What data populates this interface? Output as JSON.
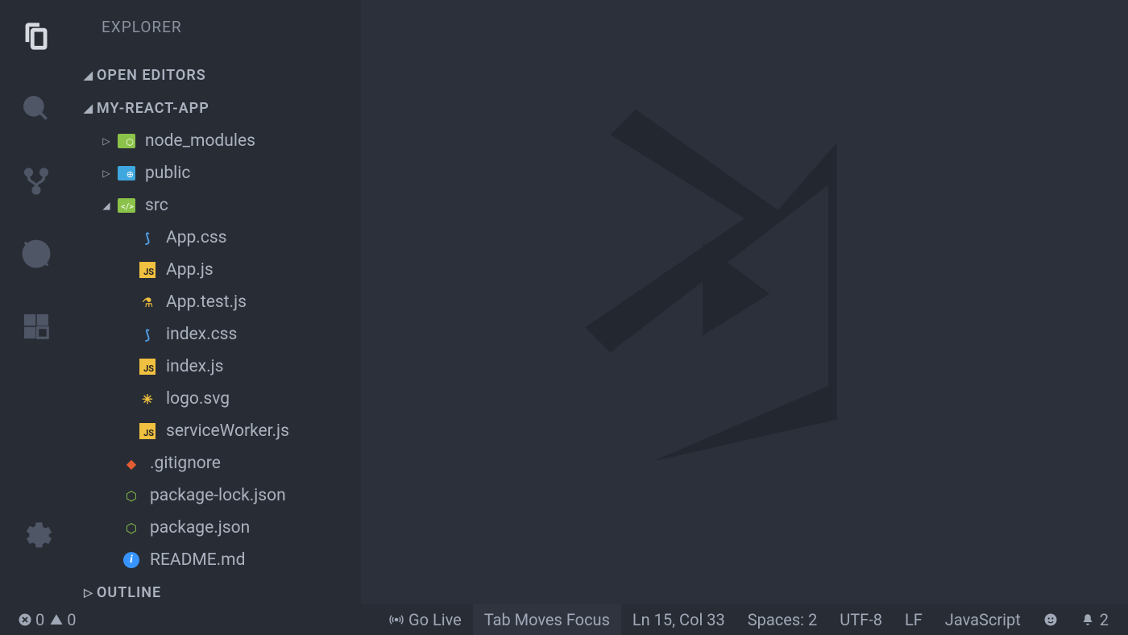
{
  "sidebar": {
    "title": "EXPLORER",
    "sections": {
      "open_editors": "OPEN EDITORS",
      "project": "MY-REACT-APP",
      "outline": "OUTLINE"
    }
  },
  "tree": {
    "node_modules": "node_modules",
    "public": "public",
    "src": "src",
    "app_css": "App.css",
    "app_js": "App.js",
    "app_test": "App.test.js",
    "index_css": "index.css",
    "index_js": "index.js",
    "logo_svg": "logo.svg",
    "service_worker": "serviceWorker.js",
    "gitignore": ".gitignore",
    "package_lock": "package-lock.json",
    "package_json": "package.json",
    "readme": "README.md"
  },
  "status": {
    "errors": "0",
    "warnings": "0",
    "go_live": "Go Live",
    "tab_moves": "Tab Moves Focus",
    "cursor": "Ln 15, Col 33",
    "spaces": "Spaces: 2",
    "encoding": "UTF-8",
    "eol": "LF",
    "language": "JavaScript",
    "notifications": "2"
  }
}
